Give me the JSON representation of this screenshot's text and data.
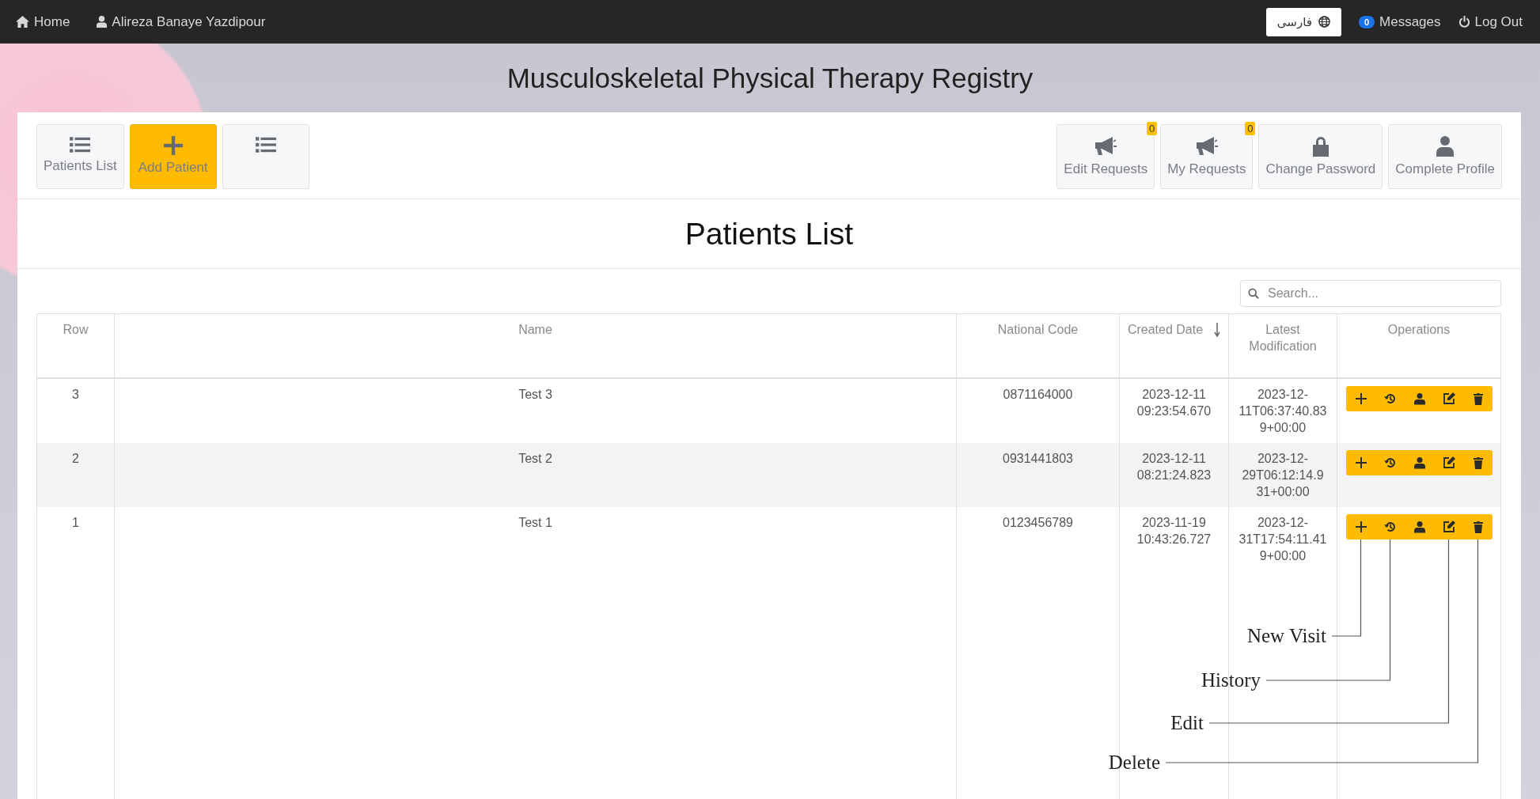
{
  "top_bar": {
    "home": "Home",
    "user": "Alireza Banaye Yazdipour",
    "language": "فارسی",
    "messages": {
      "label": "Messages",
      "count": "0"
    },
    "logout": "Log Out"
  },
  "title": "Musculoskeletal Physical Therapy Registry",
  "toolbar_left": [
    {
      "label": "Patients List",
      "kind": "list",
      "selected": false
    },
    {
      "label": "Add Patient",
      "kind": "plus",
      "selected": true
    },
    {
      "kind": "list",
      "selected": false
    }
  ],
  "toolbar_right": [
    {
      "label": "Edit Requests",
      "kind": "megaphone",
      "badge": "0"
    },
    {
      "label": "My Requests",
      "kind": "megaphone",
      "badge": "0"
    },
    {
      "label": "Change Password",
      "kind": "lock"
    },
    {
      "label": "Complete Profile",
      "kind": "user"
    }
  ],
  "heading": "Patients List",
  "search": {
    "placeholder": "Search..."
  },
  "table": {
    "columns": [
      "Row",
      "Name",
      "National Code",
      "Created Date",
      "Latest Modification",
      "Operations"
    ],
    "rows": [
      {
        "row": "3",
        "name": "Test 3",
        "national_code": "0871164000",
        "created_date": "2023-12-11 09:23:54.670",
        "latest_modification": "2023-12-11T06:37:40.839+00:00"
      },
      {
        "row": "2",
        "name": "Test 2",
        "national_code": "0931441803",
        "created_date": "2023-12-11 08:21:24.823",
        "latest_modification": "2023-12-29T06:12:14.931+00:00"
      },
      {
        "row": "1",
        "name": "Test 1",
        "national_code": "0123456789",
        "created_date": "2023-11-19 10:43:26.727",
        "latest_modification": "2023-12-31T17:54:11.419+00:00"
      }
    ]
  },
  "annotations": [
    {
      "label": "New Visit"
    },
    {
      "label": "History"
    },
    {
      "label": "Edit"
    },
    {
      "label": "Delete"
    }
  ]
}
